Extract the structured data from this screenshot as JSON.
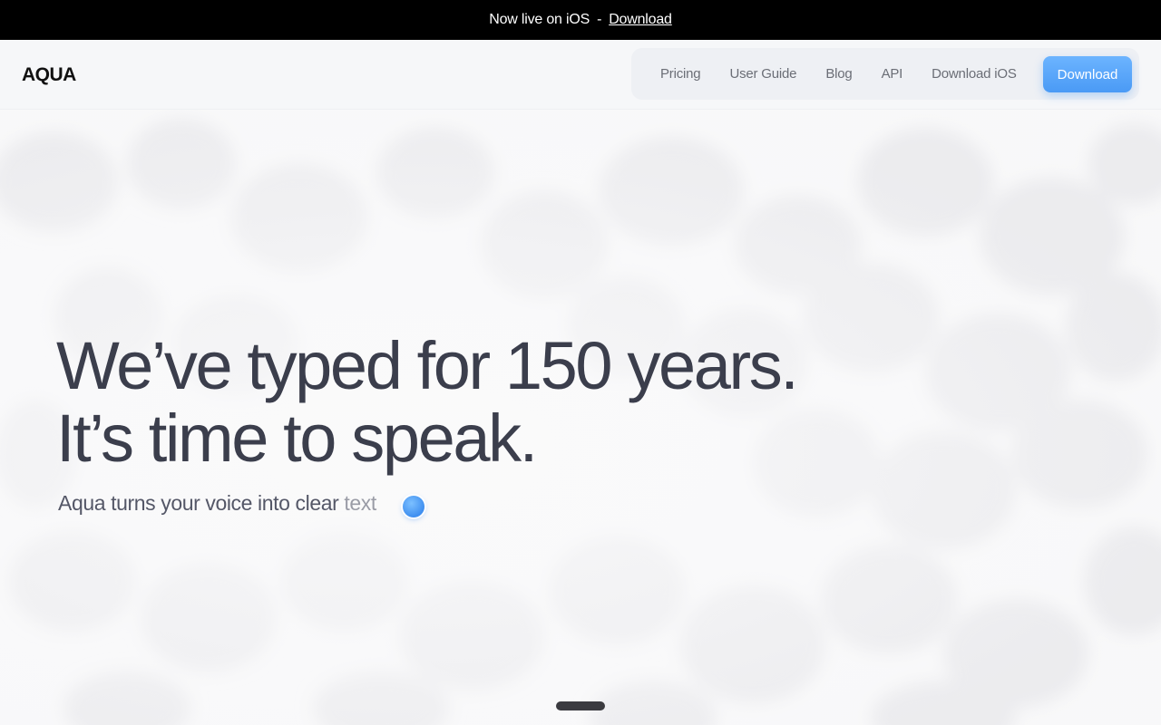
{
  "announcement": {
    "text": "Now live on iOS",
    "separator": "-",
    "link_label": "Download"
  },
  "header": {
    "logo": "AQUA",
    "nav": [
      {
        "label": "Pricing"
      },
      {
        "label": "User Guide"
      },
      {
        "label": "Blog"
      },
      {
        "label": "API"
      },
      {
        "label": "Download iOS"
      }
    ],
    "cta_label": "Download"
  },
  "hero": {
    "headline_line1": "We’ve typed for 150 years.",
    "headline_line2": "It’s time to speak.",
    "subline_main": "Aqua turns your voice into clear ",
    "subline_fade": "text"
  },
  "colors": {
    "accent": "#4a9af5",
    "headline": "#3b3e4c",
    "announcement_bg": "#000000"
  }
}
